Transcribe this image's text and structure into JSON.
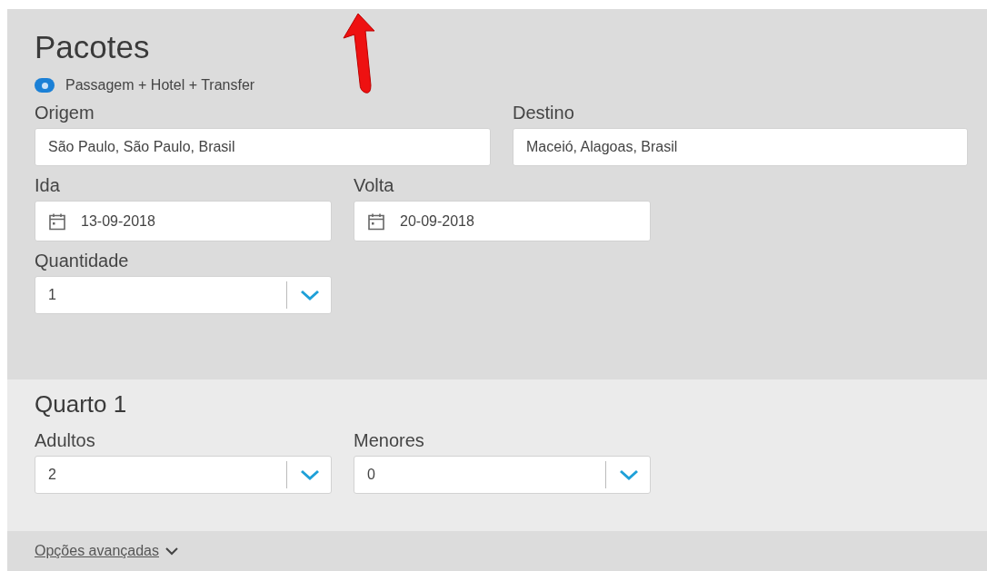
{
  "title": "Pacotes",
  "package_options": [
    {
      "label": "Passagem + Hotel + Transfer",
      "selected": true
    }
  ],
  "origin": {
    "label": "Origem",
    "value": "São Paulo, São Paulo, Brasil"
  },
  "destination": {
    "label": "Destino",
    "value": "Maceió, Alagoas, Brasil"
  },
  "dates": [
    {
      "label": "Ida",
      "value": "13-09-2018"
    },
    {
      "label": "Volta",
      "value": "20-09-2018"
    }
  ],
  "quantity": {
    "label": "Quantidade",
    "value": "1"
  },
  "rooms": [
    {
      "title": "Quarto 1",
      "selects": [
        {
          "label": "Adultos",
          "value": "2"
        },
        {
          "label": "Menores",
          "value": "0"
        }
      ]
    }
  ],
  "advanced_options": {
    "label": "Opções avançadas",
    "expanded": false
  }
}
